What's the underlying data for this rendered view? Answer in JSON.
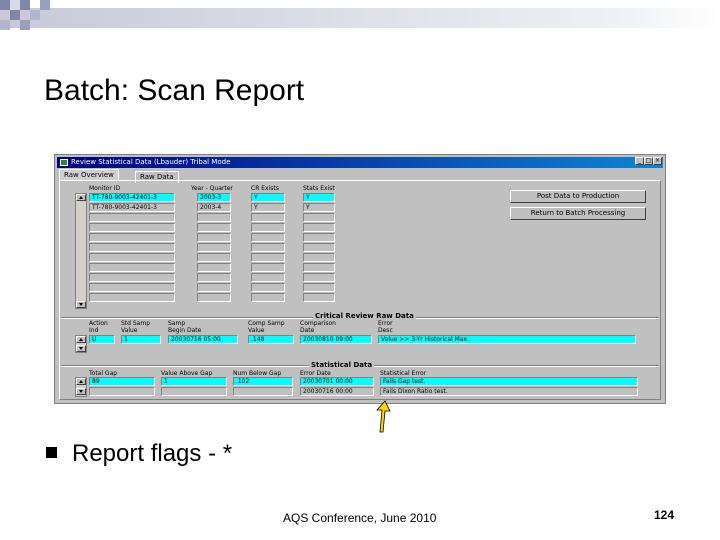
{
  "slide": {
    "title": "Batch: Scan Report",
    "bullet": "Report flags  - *",
    "footer": "AQS Conference, June 2010",
    "page_number": "124"
  },
  "window": {
    "title": "Review Statistical Data (Lbauder) Tribal Mode",
    "tabs": [
      "Raw Overview",
      "Raw Data"
    ],
    "active_tab": "Raw Overview"
  },
  "overview": {
    "headers": {
      "monitor_id": "Monitor ID",
      "year_quarter": "Year - Quarter",
      "cr_exists": "CR Exists",
      "stats_exist": "Stats Exist"
    },
    "rows": [
      {
        "monitor_id": "TT-780-9003-42401-3",
        "year_quarter": "2003-3",
        "cr_exists": "Y",
        "stats_exist": "Y"
      },
      {
        "monitor_id": "TT-780-9003-42401-3",
        "year_quarter": "2003-4",
        "cr_exists": "Y",
        "stats_exist": "Y"
      }
    ],
    "buttons": {
      "post": "Post Data to Production",
      "return": "Return to Batch Processing"
    }
  },
  "critical_review": {
    "section_title": "Critical Review Raw Data",
    "headers": {
      "action": "Action\nInd",
      "std_samp": "Std Samp\nValue",
      "samp_begin": "Samp\nBegin Date",
      "comp_samp": "Comp Samp\nValue",
      "comparison": "Comparison\nDate",
      "error": "Error\nDesc"
    },
    "row": {
      "action": "U",
      "std_samp": "1",
      "samp_begin": "20030716 05:00",
      "comp_samp": ".148",
      "comparison": "20030810 09:00",
      "error": "Value >> 3-Yr Historical Max."
    }
  },
  "statistical": {
    "section_title": "Statistical Data",
    "headers": {
      "total_gap": "Total Gap",
      "value_above": "Value Above Gap",
      "num_below": "Num Below Gap",
      "error_date": "Error Date",
      "stat_error": "Statistical Error"
    },
    "rows": [
      {
        "total_gap": "89",
        "value_above": "1",
        "num_below": ".102",
        "error_date": "20030701 00:00",
        "stat_error": "Fails Gap test."
      },
      {
        "total_gap": "",
        "value_above": "",
        "num_below": "",
        "error_date": "20030716 00:00",
        "stat_error": "Fails Dixon Ratio test."
      }
    ]
  },
  "colors": {
    "selected_field": "#00ffff",
    "titlebar": "#000080",
    "arrow": "#ffd400"
  }
}
